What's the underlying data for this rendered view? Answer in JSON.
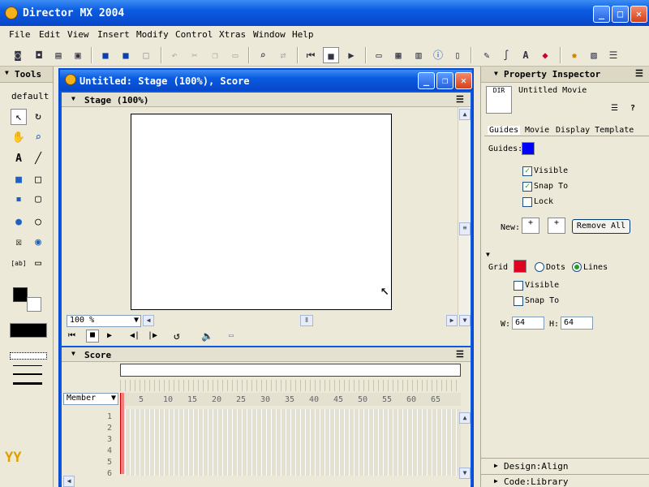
{
  "app": {
    "title": "Director MX 2004"
  },
  "menu": [
    "File",
    "Edit",
    "View",
    "Insert",
    "Modify",
    "Control",
    "Xtras",
    "Window",
    "Help"
  ],
  "tools": {
    "title": "Tools",
    "mode": "default"
  },
  "doc": {
    "title": "Untitled: Stage (100%), Score",
    "stage_title": "Stage (100%)",
    "zoom": "100 %",
    "score_title": "Score",
    "member_select": "Member",
    "frame_labels": [
      "5",
      "10",
      "15",
      "20",
      "25",
      "30",
      "35",
      "40",
      "45",
      "50",
      "55",
      "60",
      "65"
    ],
    "channels": [
      "1",
      "2",
      "3",
      "4",
      "5",
      "6"
    ]
  },
  "inspector": {
    "title": "Property Inspector",
    "movie_name": "Untitled Movie",
    "tabs": [
      "Guides",
      "Movie",
      "Display Template"
    ],
    "guides_label": "Guides:",
    "visible": "Visible",
    "snap": "Snap To",
    "lock": "Lock",
    "new_label": "New:",
    "remove_all": "Remove All",
    "grid_label": "Grid",
    "dots": "Dots",
    "lines": "Lines",
    "grid_visible": "Visible",
    "grid_snap": "Snap To",
    "w_label": "W:",
    "w_value": "64",
    "h_label": "H:",
    "h_value": "64",
    "design_align": "Design:Align",
    "code_library": "Code:Library"
  },
  "colors": {
    "guides": "#0000ff",
    "grid": "#e00020"
  }
}
